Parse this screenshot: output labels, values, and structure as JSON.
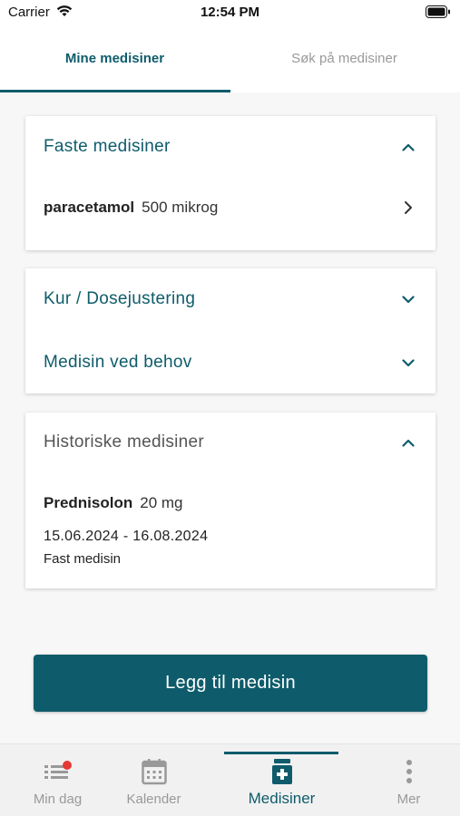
{
  "status": {
    "carrier": "Carrier",
    "time": "12:54 PM"
  },
  "tabs": [
    {
      "label": "Mine medisiner",
      "active": true
    },
    {
      "label": "Søk på medisiner",
      "active": false
    }
  ],
  "sections": {
    "faste": {
      "title": "Faste medisiner",
      "expanded": true,
      "items": [
        {
          "name": "paracetamol",
          "dose": "500 mikrog"
        }
      ]
    },
    "kur": {
      "title": "Kur / Dosejustering",
      "expanded": false
    },
    "behov": {
      "title": "Medisin ved behov",
      "expanded": false
    },
    "historiske": {
      "title": "Historiske medisiner",
      "expanded": true,
      "items": [
        {
          "name": "Prednisolon",
          "dose": "20 mg",
          "period": "15.06.2024 - 16.08.2024",
          "type": "Fast medisin"
        }
      ]
    }
  },
  "add_button_label": "Legg til medisin",
  "nav": [
    {
      "label": "Min dag",
      "icon": "list-with-badge-icon",
      "active": false
    },
    {
      "label": "Kalender",
      "icon": "calendar-icon",
      "active": false
    },
    {
      "label": "Medisiner",
      "icon": "medicine-bottle-icon",
      "active": true
    },
    {
      "label": "Mer",
      "icon": "more-vertical-icon",
      "active": false
    }
  ],
  "colors": {
    "accent": "#0e5c6b",
    "badge": "#e53935",
    "muted": "#999999"
  }
}
